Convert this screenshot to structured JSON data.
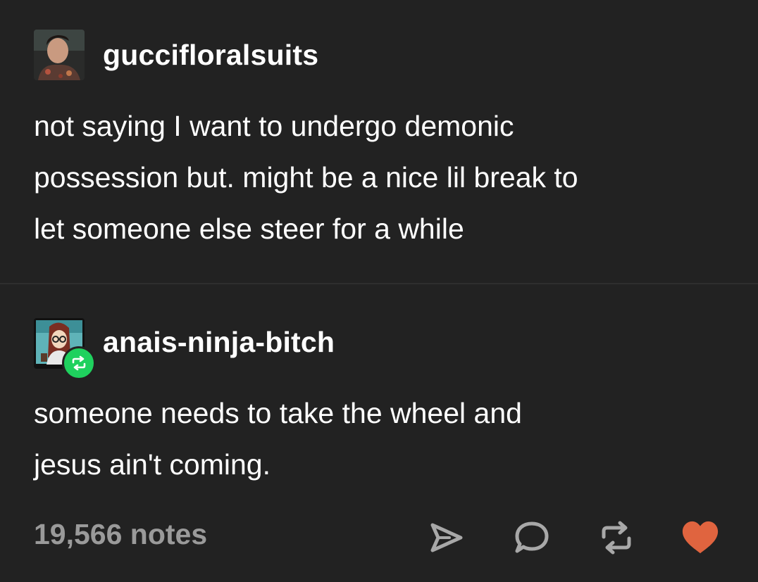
{
  "original_post": {
    "username": "guccifloralsuits",
    "lines": [
      "not saying I want to undergo demonic",
      "possession but. might be a nice lil break to",
      "let someone else steer for a while"
    ]
  },
  "reblog_post": {
    "username": "anais-ninja-bitch",
    "badge_icon": "reblog-icon",
    "lines": [
      "someone needs to take the wheel and",
      "jesus ain't coming."
    ]
  },
  "footer": {
    "notes_label": "19,566 notes",
    "actions": [
      "share-icon",
      "reply-icon",
      "reblog-icon",
      "like-icon"
    ]
  },
  "colors": {
    "background": "#222222",
    "text": "#ffffff",
    "muted": "#9a9a9a",
    "reblog_green": "#1fd15e",
    "like_red": "#e0643f"
  }
}
